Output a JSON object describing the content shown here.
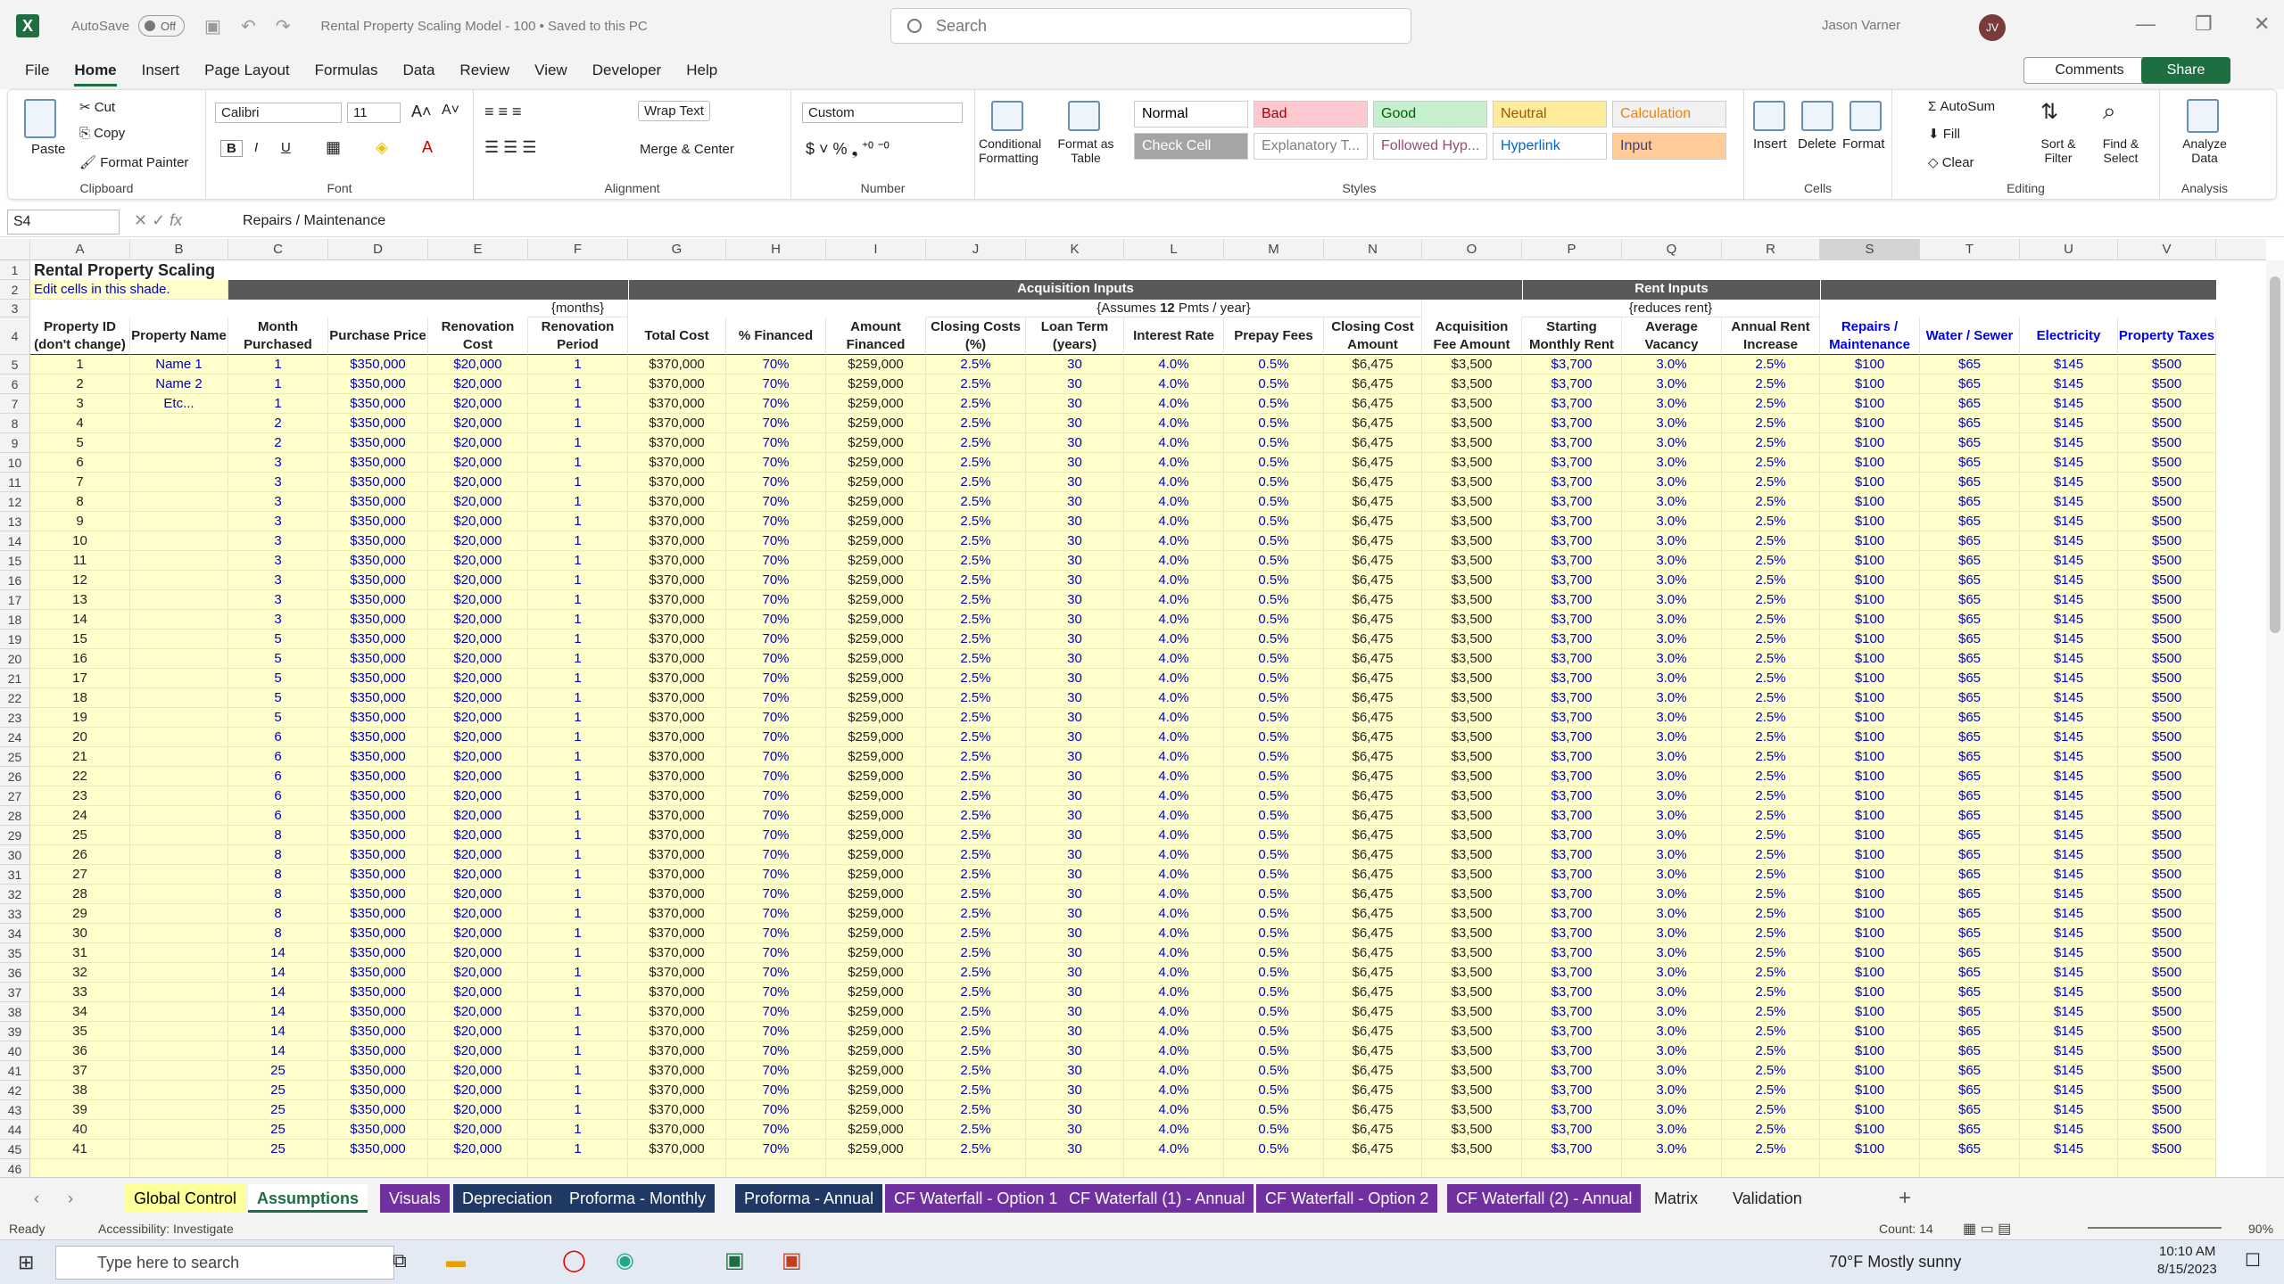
{
  "app": {
    "title": "Rental Property Scaling Model - 100 • Saved to this PC",
    "autosave_label": "AutoSave",
    "autosave_state": "Off",
    "search_placeholder": "Search",
    "user_name": "Jason Varner",
    "user_initials": "JV"
  },
  "menu": [
    "File",
    "Home",
    "Insert",
    "Page Layout",
    "Formulas",
    "Data",
    "Review",
    "View",
    "Developer",
    "Help"
  ],
  "menu_active": "Home",
  "buttons": {
    "comments": "Comments",
    "share": "Share"
  },
  "ribbon": {
    "clipboard": {
      "paste": "Paste",
      "cut": "Cut",
      "copy": "Copy",
      "format_painter": "Format Painter",
      "label": "Clipboard"
    },
    "font": {
      "name": "Calibri",
      "size": "11",
      "label": "Font"
    },
    "alignment": {
      "wrap_text": "Wrap Text",
      "merge_center": "Merge & Center",
      "label": "Alignment"
    },
    "number": {
      "format": "Custom",
      "label": "Number"
    },
    "styles": {
      "conditional": "Conditional Formatting",
      "format_table": "Format as Table",
      "label": "Styles",
      "cells": [
        {
          "name": "Normal",
          "bg": "#ffffff",
          "fg": "#000000"
        },
        {
          "name": "Bad",
          "bg": "#ffc7ce",
          "fg": "#9c0006"
        },
        {
          "name": "Good",
          "bg": "#c6efce",
          "fg": "#006100"
        },
        {
          "name": "Neutral",
          "bg": "#ffeb9c",
          "fg": "#9c5700"
        },
        {
          "name": "Calculation",
          "bg": "#f2f2f2",
          "fg": "#fa7d00"
        },
        {
          "name": "Check Cell",
          "bg": "#a5a5a5",
          "fg": "#ffffff"
        },
        {
          "name": "Explanatory T...",
          "bg": "#ffffff",
          "fg": "#7f7f7f"
        },
        {
          "name": "Followed Hyp...",
          "bg": "#ffffff",
          "fg": "#954f72"
        },
        {
          "name": "Hyperlink",
          "bg": "#ffffff",
          "fg": "#0563c1"
        },
        {
          "name": "Input",
          "bg": "#ffcc99",
          "fg": "#3f3f76"
        }
      ]
    },
    "cells": {
      "insert": "Insert",
      "delete": "Delete",
      "format": "Format",
      "label": "Cells"
    },
    "editing": {
      "autosum": "AutoSum",
      "fill": "Fill",
      "clear": "Clear",
      "sort": "Sort & Filter",
      "find": "Find & Select",
      "label": "Editing"
    },
    "analysis": {
      "analyze": "Analyze Data",
      "label": "Analysis"
    }
  },
  "formula_bar": {
    "cell_ref": "S4",
    "formula": "Repairs / Maintenance"
  },
  "columns": [
    "A",
    "B",
    "C",
    "D",
    "E",
    "F",
    "G",
    "H",
    "I",
    "J",
    "K",
    "L",
    "M",
    "N",
    "O",
    "P",
    "Q",
    "R",
    "S",
    "T",
    "U",
    "V"
  ],
  "sheet": {
    "title": "Rental Property Scaling",
    "edit_note": "Edit cells in this shade.",
    "band_acq": "Acquisition Inputs",
    "band_rent": "Rent Inputs",
    "note_months": "{months}",
    "note_pmts_pre": "{Assumes ",
    "note_pmts_num": "12",
    "note_pmts_post": " Pmts / year}",
    "note_rent": "{reduces rent}",
    "headers": [
      "Property ID (don't change)",
      "Property Name",
      "Month Purchased",
      "Purchase Price",
      "Renovation Cost",
      "Renovation Period",
      "Total Cost",
      "% Financed",
      "Amount Financed",
      "Closing Costs (%)",
      "Loan Term (years)",
      "Interest Rate",
      "Prepay Fees",
      "Closing Cost Amount",
      "Acquisition Fee Amount",
      "Starting Monthly Rent",
      "Average Vacancy",
      "Annual Rent Increase",
      "Repairs / Maintenance",
      "Water / Sewer",
      "Electricity",
      "Property Taxes"
    ],
    "names": [
      "Name 1",
      "Name 2",
      "Etc..."
    ],
    "months": [
      1,
      1,
      1,
      2,
      2,
      3,
      3,
      3,
      3,
      3,
      3,
      3,
      3,
      3,
      5,
      5,
      5,
      5,
      5,
      6,
      6,
      6,
      6,
      6,
      8,
      8,
      8,
      8,
      8,
      8,
      14,
      14,
      14,
      14,
      14,
      14,
      25,
      25,
      25,
      25,
      25
    ],
    "defaults": {
      "price": "$350,000",
      "reno": "$20,000",
      "period": "1",
      "total": "$370,000",
      "financed": "70%",
      "amount": "$259,000",
      "closing": "2.5%",
      "term": "30",
      "rate": "4.0%",
      "prepay": "0.5%",
      "cc_amount": "$6,475",
      "acq_fee": "$3,500",
      "rent": "$3,700",
      "vacancy": "3.0%",
      "increase": "2.5%",
      "repairs": "$100",
      "water": "$65",
      "electric": "$145",
      "taxes": "$500"
    }
  },
  "sheet_tabs": [
    {
      "name": "Global Control",
      "bg": "#ffff99",
      "fg": "#000000"
    },
    {
      "name": "Assumptions",
      "bg": "#ffffff",
      "fg": "#1d6f42"
    },
    {
      "name": "Visuals",
      "bg": "#7030a0",
      "fg": "#ffffff"
    },
    {
      "name": "Depreciation",
      "bg": "#1f3864",
      "fg": "#ffffff"
    },
    {
      "name": "Proforma - Monthly",
      "bg": "#1f3864",
      "fg": "#ffffff"
    },
    {
      "name": "Proforma - Annual",
      "bg": "#1f3864",
      "fg": "#ffffff"
    },
    {
      "name": "CF Waterfall - Option 1",
      "bg": "#7030a0",
      "fg": "#ffffff"
    },
    {
      "name": "CF Waterfall (1) - Annual",
      "bg": "#7030a0",
      "fg": "#ffffff"
    },
    {
      "name": "CF Waterfall - Option 2",
      "bg": "#7030a0",
      "fg": "#ffffff"
    },
    {
      "name": "CF Waterfall (2) - Annual",
      "bg": "#7030a0",
      "fg": "#ffffff"
    },
    {
      "name": "Matrix",
      "bg": "#f3f3f3",
      "fg": "#222222"
    },
    {
      "name": "Validation",
      "bg": "#f3f3f3",
      "fg": "#222222"
    }
  ],
  "status": {
    "ready": "Ready",
    "accessibility": "Accessibility: Investigate",
    "count": "Count: 14",
    "zoom": "90%"
  },
  "taskbar": {
    "search": "Type here to search",
    "weather": "70°F  Mostly sunny",
    "time": "10:10 AM",
    "date": "8/15/2023"
  }
}
